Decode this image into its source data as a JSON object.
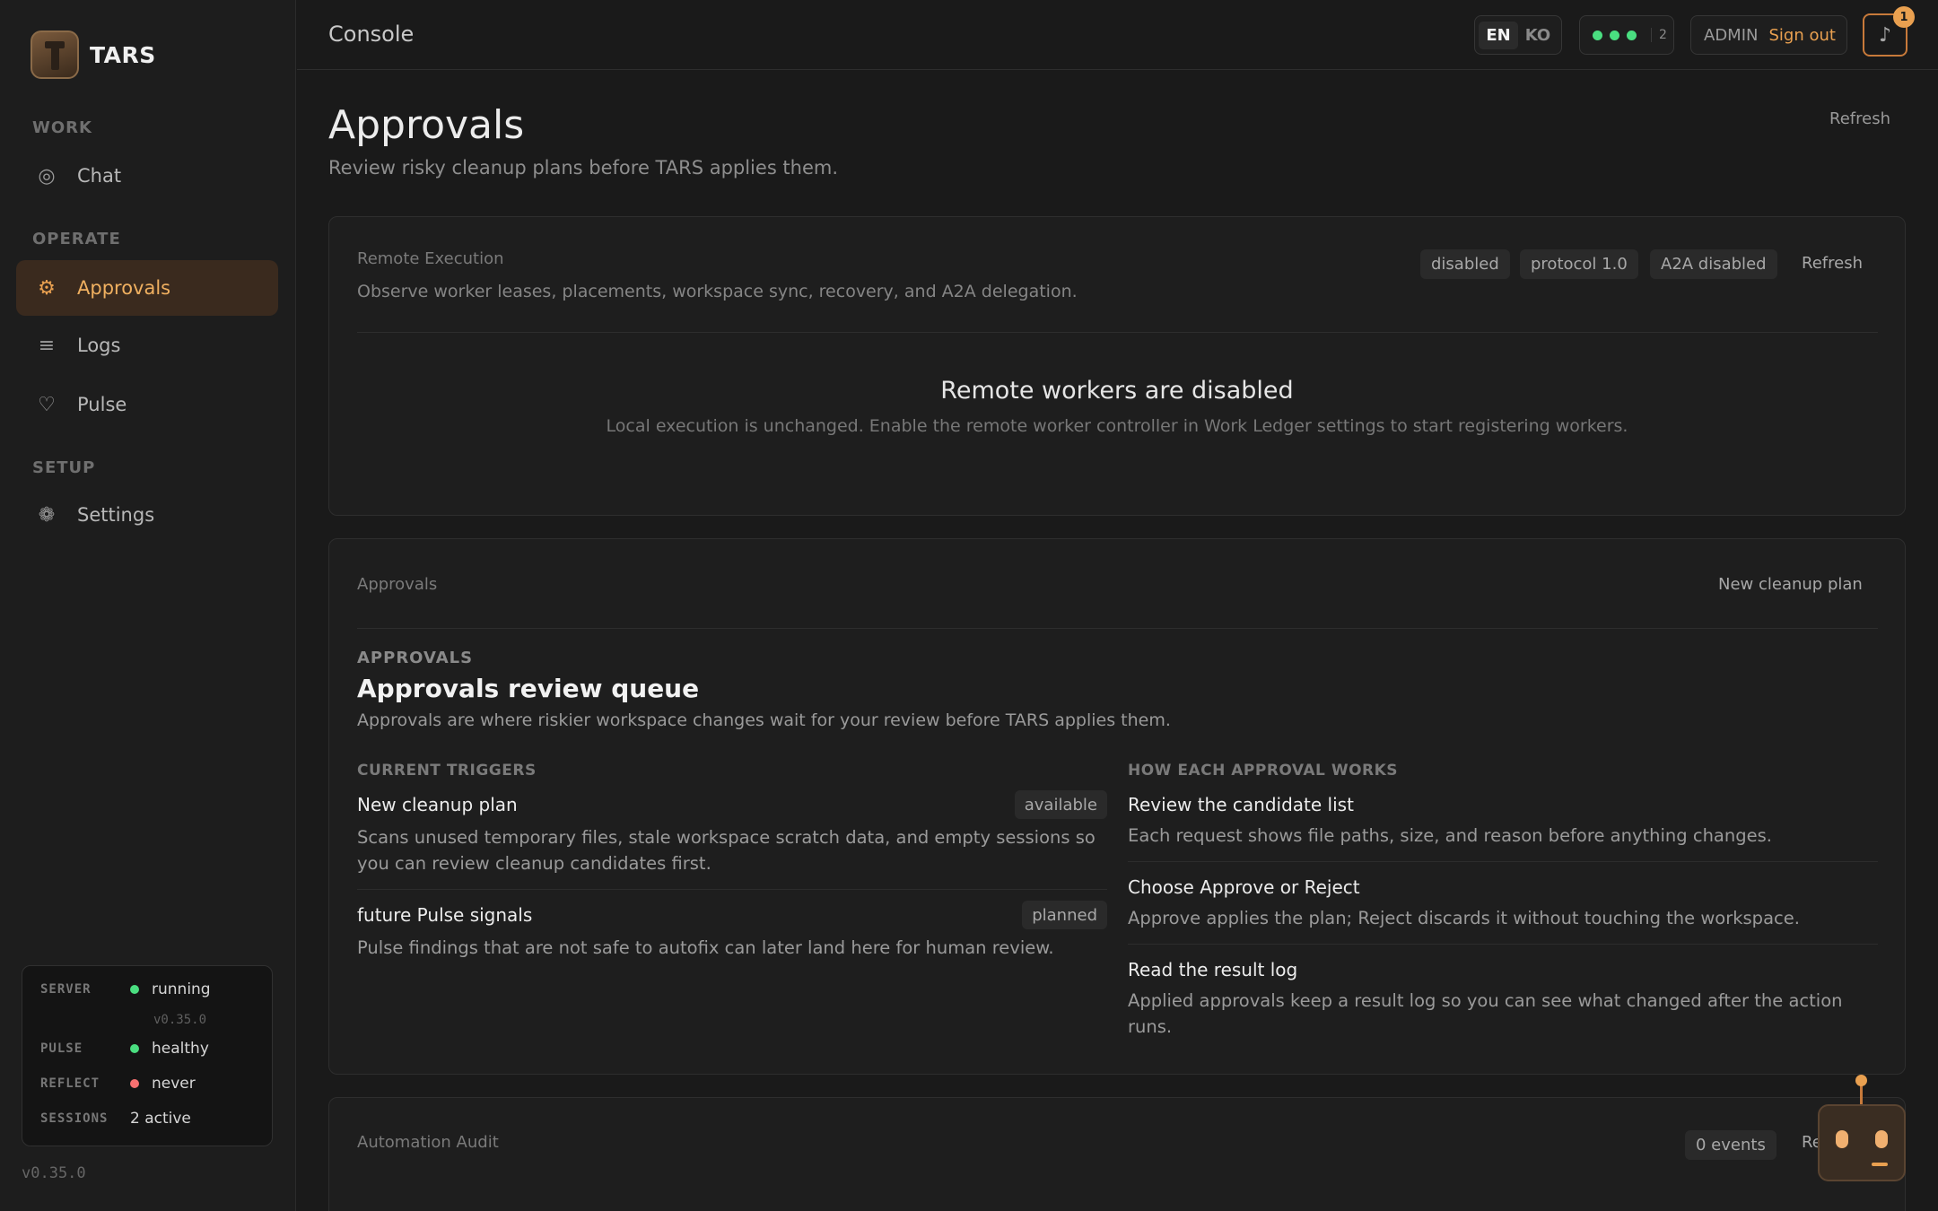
{
  "sidebar": {
    "brand": "TARS",
    "sections": {
      "work": "WORK",
      "operate": "OPERATE",
      "setup": "SETUP"
    },
    "items": {
      "chat": "Chat",
      "approvals": "Approvals",
      "logs": "Logs",
      "pulse": "Pulse",
      "settings": "Settings"
    },
    "status": {
      "server_label": "SERVER",
      "server_value": "running",
      "server_version": "v0.35.0",
      "pulse_label": "PULSE",
      "pulse_value": "healthy",
      "reflect_label": "REFLECT",
      "reflect_value": "never",
      "sessions_label": "SESSIONS",
      "sessions_value": "2 active",
      "ok_color": "#4ade80",
      "bad_color": "#f87171"
    },
    "version": "v0.35.0"
  },
  "topbar": {
    "title": "Console",
    "lang_en": "EN",
    "lang_ko": "KO",
    "indicator_count": "2",
    "role": "ADMIN",
    "sign_out": "Sign out",
    "notification_count": "1",
    "accent": "#e9a050"
  },
  "page": {
    "title": "Approvals",
    "subtitle": "Review risky cleanup plans before TARS applies them.",
    "refresh": "Refresh"
  },
  "remote": {
    "label": "Remote Execution",
    "description": "Observe worker leases, placements, workspace sync, recovery, and A2A delegation.",
    "chips": [
      "disabled",
      "protocol 1.0",
      "A2A disabled"
    ],
    "refresh": "Refresh",
    "empty_title": "Remote workers are disabled",
    "empty_sub": "Local execution is unchanged. Enable the remote worker controller in Work Ledger settings to start registering workers."
  },
  "approvals": {
    "label": "Approvals",
    "new_plan": "New cleanup plan",
    "eyebrow": "APPROVALS",
    "title": "Approvals review queue",
    "description": "Approvals are where riskier workspace changes wait for your review before TARS applies them.",
    "triggers_heading": "CURRENT TRIGGERS",
    "triggers": [
      {
        "title": "New cleanup plan",
        "status": "available",
        "description": "Scans unused temporary files, stale workspace scratch data, and empty sessions so you can review cleanup candidates first."
      },
      {
        "title": "future Pulse signals",
        "status": "planned",
        "description": "Pulse findings that are not safe to autofix can later land here for human review."
      }
    ],
    "how_heading": "HOW EACH APPROVAL WORKS",
    "steps": [
      {
        "title": "Review the candidate list",
        "description": "Each request shows file paths, size, and reason before anything changes."
      },
      {
        "title": "Choose Approve or Reject",
        "description": "Approve applies the plan; Reject discards it without touching the workspace."
      },
      {
        "title": "Read the result log",
        "description": "Applied approvals keep a result log so you can see what changed after the action runs."
      }
    ]
  },
  "audit": {
    "label": "Automation Audit",
    "events": "0 events",
    "refresh_partial": "Re"
  },
  "icons": {
    "chat": "target-icon",
    "approvals": "gear-icon",
    "logs": "list-icon",
    "pulse": "heart-icon",
    "settings": "cog-icon",
    "notification": "music-note-icon"
  }
}
